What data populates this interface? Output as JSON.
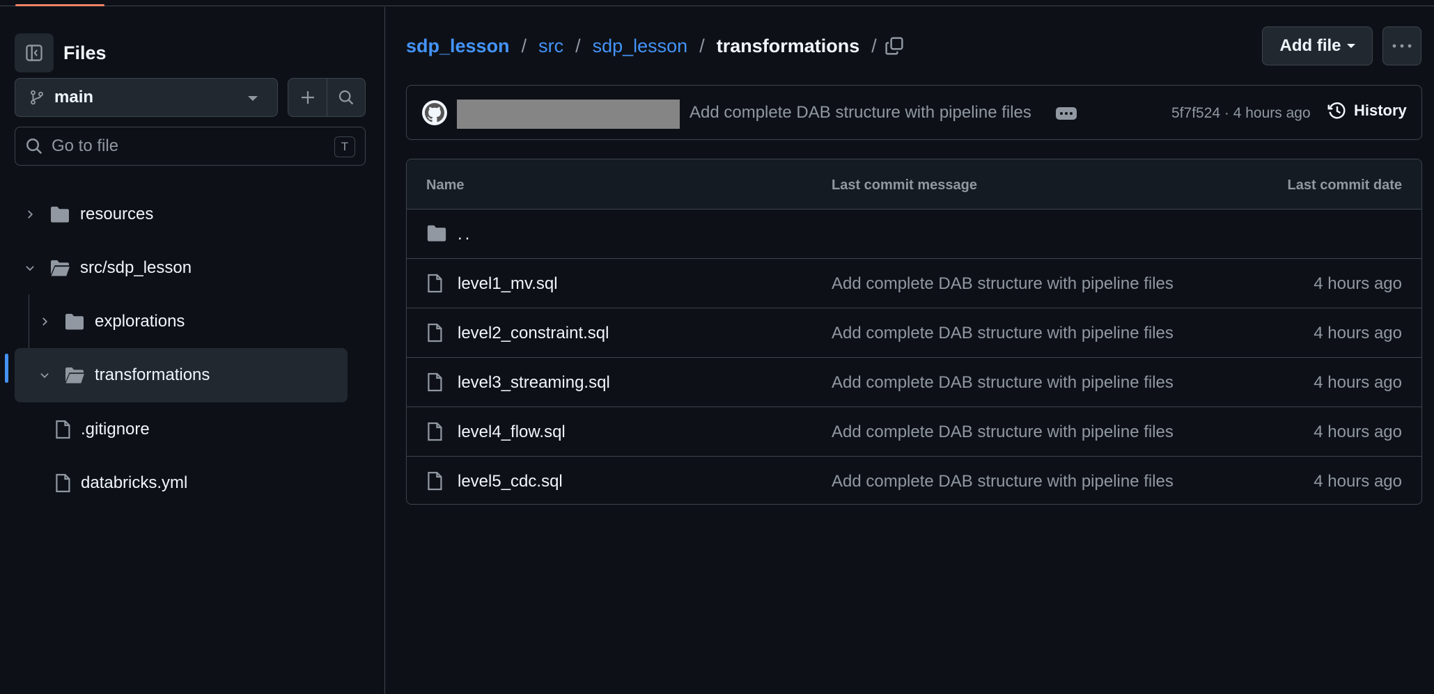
{
  "sidebar": {
    "title": "Files",
    "branch": "main",
    "goto_placeholder": "Go to file",
    "goto_shortcut": "T",
    "tree": [
      {
        "label": "resources",
        "type": "folder",
        "expanded": false,
        "depth": 0
      },
      {
        "label": "src/sdp_lesson",
        "type": "folder",
        "expanded": true,
        "depth": 0
      },
      {
        "label": "explorations",
        "type": "folder",
        "expanded": false,
        "depth": 1
      },
      {
        "label": "transformations",
        "type": "folder",
        "expanded": true,
        "depth": 1,
        "selected": true
      },
      {
        "label": ".gitignore",
        "type": "file",
        "depth": 0
      },
      {
        "label": "databricks.yml",
        "type": "file",
        "depth": 0
      }
    ]
  },
  "breadcrumb": {
    "parts": [
      "sdp_lesson",
      "src",
      "sdp_lesson"
    ],
    "current": "transformations",
    "separator": "/"
  },
  "toolbar": {
    "add_file_label": "Add file"
  },
  "commit": {
    "message": "Add complete DAB structure with pipeline files",
    "meta": "5f7f524 · 4 hours ago",
    "history_label": "History"
  },
  "table": {
    "headers": [
      "Name",
      "Last commit message",
      "Last commit date"
    ],
    "parent_label": "..",
    "rows": [
      {
        "name": "level1_mv.sql",
        "message": "Add complete DAB structure with pipeline files",
        "date": "4 hours ago"
      },
      {
        "name": "level2_constraint.sql",
        "message": "Add complete DAB structure with pipeline files",
        "date": "4 hours ago"
      },
      {
        "name": "level3_streaming.sql",
        "message": "Add complete DAB structure with pipeline files",
        "date": "4 hours ago"
      },
      {
        "name": "level4_flow.sql",
        "message": "Add complete DAB structure with pipeline files",
        "date": "4 hours ago"
      },
      {
        "name": "level5_cdc.sql",
        "message": "Add complete DAB structure with pipeline files",
        "date": "4 hours ago"
      }
    ]
  },
  "colors": {
    "background": "#0d1117",
    "accent_link": "#4493f8",
    "border": "#3d444d",
    "muted_text": "#9198a1"
  }
}
